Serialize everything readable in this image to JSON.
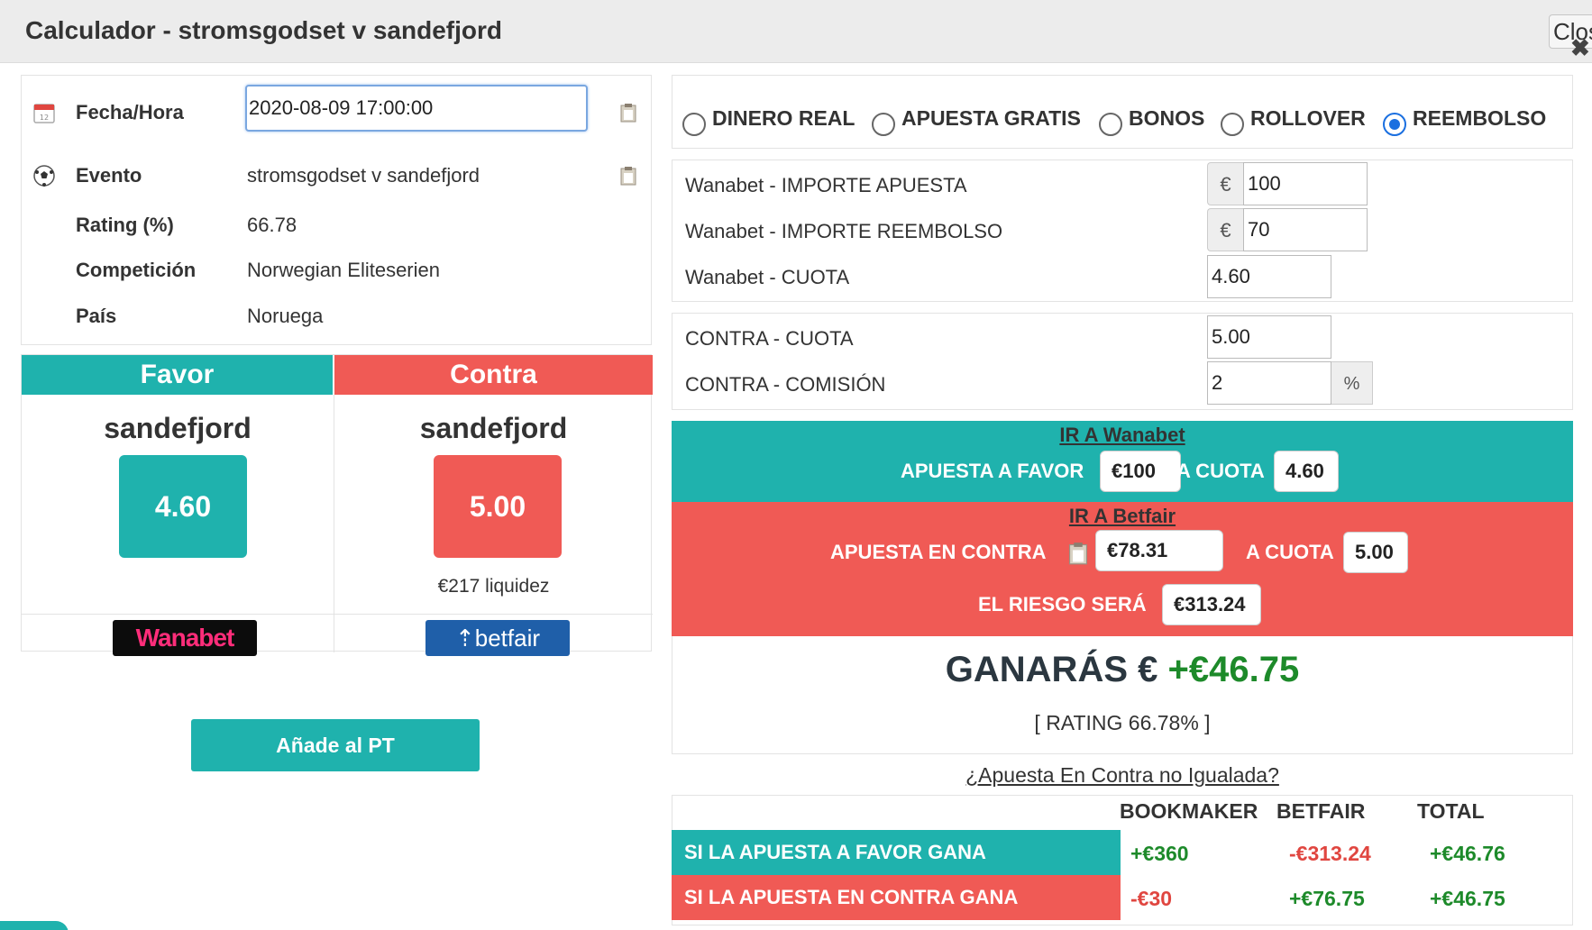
{
  "window": {
    "title": "Calculador - stromsgodset v sandefjord",
    "close_label": "Close"
  },
  "info": {
    "date_label": "Fecha/Hora",
    "date_value": "2020-08-09 17:00:00",
    "event_label": "Evento",
    "event_value": "stromsgodset v sandefjord",
    "rating_label": "Rating (%)",
    "rating_value": "66.78",
    "competition_label": "Competición",
    "competition_value": "Norwegian Eliteserien",
    "country_label": "País",
    "country_value": "Noruega"
  },
  "favor": {
    "header": "Favor",
    "team": "sandefjord",
    "odds": "4.60",
    "logo": "Wanabet"
  },
  "contra": {
    "header": "Contra",
    "team": "sandefjord",
    "odds": "5.00",
    "liquidity": "€217 liquidez",
    "logo": "betfair"
  },
  "add_button": "Añade al PT",
  "bet_types": [
    {
      "label": "DINERO REAL",
      "checked": false
    },
    {
      "label": "APUESTA GRATIS",
      "checked": false
    },
    {
      "label": "BONOS",
      "checked": false
    },
    {
      "label": "ROLLOVER",
      "checked": false
    },
    {
      "label": "REEMBOLSO",
      "checked": true
    }
  ],
  "form": {
    "stake_label": "Wanabet - IMPORTE APUESTA",
    "stake_value": "100",
    "refund_label": "Wanabet - IMPORTE REEMBOLSO",
    "refund_value": "70",
    "back_odds_label": "Wanabet - CUOTA",
    "back_odds_value": "4.60",
    "lay_odds_label": "CONTRA - CUOTA",
    "lay_odds_value": "5.00",
    "commission_label": "CONTRA - COMISIÓN",
    "commission_value": "2",
    "currency": "€",
    "percent": "%"
  },
  "back_action": {
    "link": "IR A Wanabet",
    "bet_label": "APUESTA A FAVOR",
    "stake": "€100",
    "odds_label": "A CUOTA",
    "odds": "4.60"
  },
  "lay_action": {
    "link": "IR A Betfair",
    "bet_label": "APUESTA EN CONTRA",
    "stake": "€78.31",
    "odds_label": "A CUOTA",
    "odds": "5.00",
    "risk_label": "EL RIESGO SERÁ",
    "risk": "€313.24"
  },
  "result": {
    "label": "GANARÁS €",
    "amount": "+€46.75",
    "rating": "[ RATING 66.78% ]"
  },
  "unmatched_link": "¿Apuesta En Contra no Igualada?",
  "summary": {
    "columns": [
      "BOOKMAKER",
      "BETFAIR",
      "TOTAL"
    ],
    "rows": [
      {
        "label": "SI LA APUESTA A FAVOR GANA",
        "bookmaker": "+€360",
        "betfair": "-€313.24",
        "total": "+€46.76"
      },
      {
        "label": "SI LA APUESTA EN CONTRA GANA",
        "bookmaker": "-€30",
        "betfair": "+€76.75",
        "total": "+€46.75"
      }
    ]
  },
  "colors": {
    "teal": "#1fb2ad",
    "red": "#f05a55",
    "green": "#1d8a2a",
    "radio_blue": "#1a6fe0"
  }
}
